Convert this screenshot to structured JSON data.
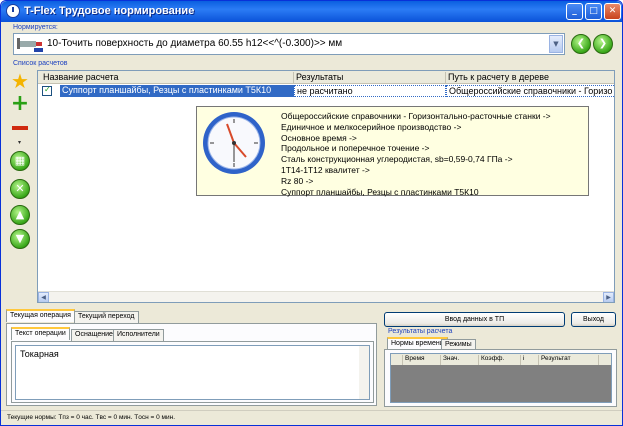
{
  "window": {
    "title": "T-Flex Трудовое нормирование"
  },
  "header": {
    "normed_label": "Нормируется:",
    "operation_value": "10-Точить поверхность  до диаметра 60.55 h12<<^(-0.300)>> мм"
  },
  "calc_list": {
    "label": "Список расчетов",
    "columns": [
      "Название расчета",
      "Результаты",
      "Путь к расчету в дереве"
    ],
    "rows": [
      {
        "checked": true,
        "name": "Суппорт планшайбы, Резцы с пластинками Т5К10",
        "result": "не расчитано",
        "path": "Общероссийские справочники - Горизо"
      }
    ]
  },
  "tooltip": {
    "lines": [
      "Общероссийские справочники - Горизонтально-расточные станки ->",
      "Единичное и мелкосерийное производство ->",
      "Основное время ->",
      "Продольное и поперечное точение ->",
      "Сталь конструкционная углеродистая, sb=0,59-0,74 ГПа ->",
      "1Т14-1Т12 квалитет ->",
      "Rz 80 ->",
      "Суппорт планшайбы, Резцы с пластинками Т5К10"
    ]
  },
  "bottom_left": {
    "tabs": [
      "Текущая операция",
      "Текущий переход"
    ],
    "subtabs": [
      "Текст операции",
      "Оснащение",
      "Исполнители"
    ],
    "operation_text": "Токарная"
  },
  "buttons": {
    "enter_tp": "Ввод данных в ТП",
    "exit": "Выход"
  },
  "results": {
    "label": "Результаты расчета",
    "tabs": [
      "Нормы времени",
      "Режимы"
    ],
    "columns": [
      "Время",
      "Знач.",
      "Коэфф.",
      "i",
      "Результат"
    ]
  },
  "status": {
    "text": "Текущие нормы:  Tпз = 0 час.   Tвс = 0 мин.   Tосн = 0 мин."
  },
  "colors": {
    "titlebar": "#0a5fe0",
    "selection": "#316ac5",
    "tooltip_bg": "#ffffe1",
    "accent_tab": "#ffc83c"
  }
}
